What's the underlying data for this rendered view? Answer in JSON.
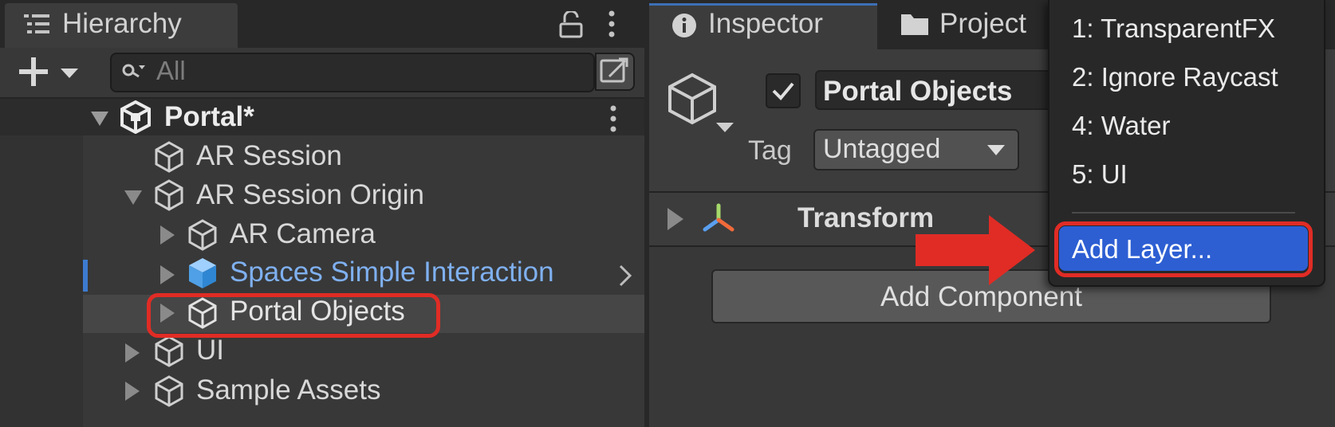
{
  "hierarchy": {
    "title": "Hierarchy",
    "search_placeholder": "All",
    "scene": "Portal*",
    "items": [
      {
        "label": "AR Session"
      },
      {
        "label": "AR Session Origin"
      },
      {
        "label": "AR Camera"
      },
      {
        "label": "Spaces Simple Interaction"
      },
      {
        "label": "Portal Objects"
      },
      {
        "label": "UI"
      },
      {
        "label": "Sample Assets"
      }
    ]
  },
  "inspector": {
    "tab_inspector": "Inspector",
    "tab_project": "Project",
    "object_name": "Portal Objects",
    "tag_label": "Tag",
    "tag_value": "Untagged",
    "component": "Transform",
    "add_component": "Add Component"
  },
  "layer_menu": {
    "items": [
      "1: TransparentFX",
      "2: Ignore Raycast",
      "4: Water",
      "5: UI"
    ],
    "add_layer": "Add Layer..."
  },
  "colors": {
    "accent_blue": "#2d5fd3",
    "prefab_blue": "#7fb0f0",
    "highlight_red": "#e02c25"
  }
}
